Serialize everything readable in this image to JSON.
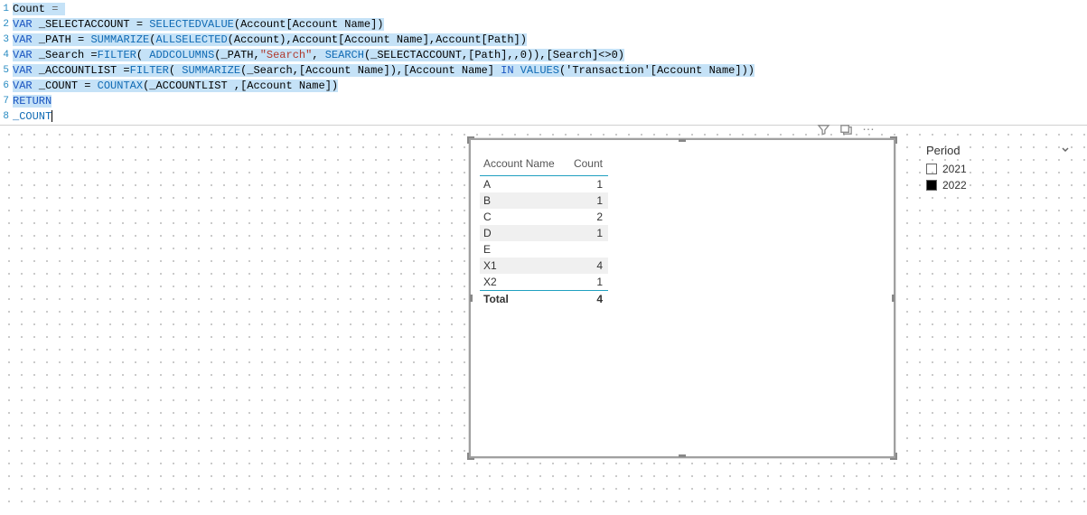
{
  "formula": {
    "lines": [
      {
        "no": 1,
        "tokens": [
          {
            "t": "Count",
            "c": "tok-id",
            "sel": true
          },
          {
            "t": " ",
            "c": "tok-plain",
            "sel": true
          },
          {
            "t": "=",
            "c": "tok-op",
            "sel": true
          },
          {
            "t": " ",
            "c": "tok-plain",
            "sel": true
          }
        ]
      },
      {
        "no": 2,
        "tokens": [
          {
            "t": "VAR",
            "c": "tok-kw",
            "sel": true
          },
          {
            "t": " ",
            "sel": true
          },
          {
            "t": "_SELECTACCOUNT",
            "c": "tok-id",
            "sel": true
          },
          {
            "t": " = ",
            "sel": true
          },
          {
            "t": "SELECTEDVALUE",
            "c": "tok-fn",
            "sel": true
          },
          {
            "t": "(Account[Account Name])",
            "c": "tok-plain",
            "sel": true
          }
        ]
      },
      {
        "no": 3,
        "tokens": [
          {
            "t": "VAR",
            "c": "tok-kw",
            "sel": true
          },
          {
            "t": " ",
            "sel": true
          },
          {
            "t": "_PATH",
            "c": "tok-id",
            "sel": true
          },
          {
            "t": " = ",
            "sel": true
          },
          {
            "t": "SUMMARIZE",
            "c": "tok-fn",
            "sel": true
          },
          {
            "t": "(",
            "sel": true
          },
          {
            "t": "ALLSELECTED",
            "c": "tok-fn",
            "sel": true
          },
          {
            "t": "(Account),Account[Account Name],Account[Path])",
            "c": "tok-plain",
            "sel": true
          }
        ]
      },
      {
        "no": 4,
        "tokens": [
          {
            "t": "VAR",
            "c": "tok-kw",
            "sel": true
          },
          {
            "t": " ",
            "sel": true
          },
          {
            "t": "_Search",
            "c": "tok-id",
            "sel": true
          },
          {
            "t": " =",
            "sel": true
          },
          {
            "t": "FILTER",
            "c": "tok-fn",
            "sel": true
          },
          {
            "t": "( ",
            "sel": true
          },
          {
            "t": "ADDCOLUMNS",
            "c": "tok-fn",
            "sel": true
          },
          {
            "t": "(_PATH,",
            "c": "tok-plain",
            "sel": true
          },
          {
            "t": "\"Search\"",
            "c": "tok-str",
            "sel": true
          },
          {
            "t": ", ",
            "sel": true
          },
          {
            "t": "SEARCH",
            "c": "tok-fn",
            "sel": true
          },
          {
            "t": "(_SELECTACCOUNT,[Path],,",
            "c": "tok-plain",
            "sel": true
          },
          {
            "t": "0",
            "c": "tok-num",
            "sel": true
          },
          {
            "t": ")),[Search]<>",
            "c": "tok-plain",
            "sel": true
          },
          {
            "t": "0",
            "c": "tok-num",
            "sel": true
          },
          {
            "t": ")",
            "c": "tok-plain",
            "sel": true
          }
        ]
      },
      {
        "no": 5,
        "tokens": [
          {
            "t": "VAR",
            "c": "tok-kw",
            "sel": true
          },
          {
            "t": " ",
            "sel": true
          },
          {
            "t": "_ACCOUNTLIST",
            "c": "tok-id",
            "sel": true
          },
          {
            "t": " =",
            "sel": true
          },
          {
            "t": "FILTER",
            "c": "tok-fn",
            "sel": true
          },
          {
            "t": "( ",
            "sel": true
          },
          {
            "t": "SUMMARIZE",
            "c": "tok-fn",
            "sel": true
          },
          {
            "t": "(_Search,[Account Name]),[Account Name] ",
            "c": "tok-plain",
            "sel": true
          },
          {
            "t": "IN",
            "c": "tok-kw",
            "sel": true
          },
          {
            "t": " ",
            "sel": true
          },
          {
            "t": "VALUES",
            "c": "tok-fn",
            "sel": true
          },
          {
            "t": "('Transaction'[Account Name]))",
            "c": "tok-plain",
            "sel": true
          }
        ]
      },
      {
        "no": 6,
        "tokens": [
          {
            "t": "VAR",
            "c": "tok-kw",
            "sel": true
          },
          {
            "t": " ",
            "sel": true
          },
          {
            "t": "_COUNT",
            "c": "tok-id",
            "sel": true
          },
          {
            "t": " = ",
            "sel": true
          },
          {
            "t": "COUNTAX",
            "c": "tok-fn",
            "sel": true
          },
          {
            "t": "(_ACCOUNTLIST ,[Account Name])",
            "c": "tok-plain",
            "sel": true
          }
        ]
      },
      {
        "no": 7,
        "tokens": [
          {
            "t": "RETURN",
            "c": "tok-kw",
            "sel": true
          }
        ]
      },
      {
        "no": 8,
        "cursor": true,
        "tokens": [
          {
            "t": "_COUNT",
            "c": "no-sel",
            "sel": false
          }
        ]
      }
    ]
  },
  "table": {
    "headers": {
      "col1": "Account Name",
      "col2": "Count"
    },
    "rows": [
      {
        "name": "A",
        "count": "1",
        "alt": false
      },
      {
        "name": "B",
        "count": "1",
        "alt": true
      },
      {
        "name": "C",
        "count": "2",
        "alt": false
      },
      {
        "name": "D",
        "count": "1",
        "alt": true
      },
      {
        "name": "E",
        "count": "",
        "alt": false
      },
      {
        "name": "X1",
        "count": "4",
        "alt": true
      },
      {
        "name": "X2",
        "count": "1",
        "alt": false
      }
    ],
    "total": {
      "label": "Total",
      "value": "4"
    }
  },
  "slicer": {
    "title": "Period",
    "items": [
      {
        "label": "2021",
        "checked": false
      },
      {
        "label": "2022",
        "checked": true
      }
    ]
  },
  "icons": {
    "filter": "filter-icon",
    "focus": "focus-icon",
    "more": "…"
  }
}
